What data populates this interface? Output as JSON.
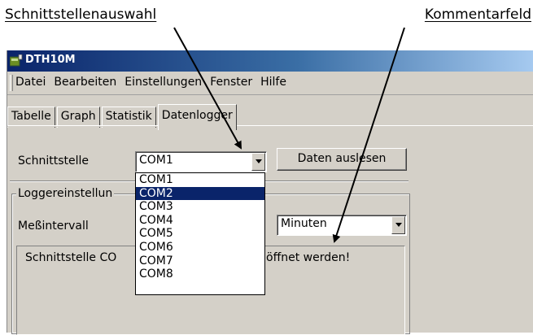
{
  "annotations": {
    "left": "Schnittstellenauswahl",
    "right": "Kommentarfeld"
  },
  "window": {
    "title": "DTH10M",
    "icon": "app-icon"
  },
  "menu": [
    "Datei",
    "Bearbeiten",
    "Einstellungen",
    "Fenster",
    "Hilfe"
  ],
  "tabs": [
    "Tabelle",
    "Graph",
    "Statistik",
    "Datenlogger"
  ],
  "active_tab": "Datenlogger",
  "interface": {
    "label": "Schnittstelle",
    "value": "COM1",
    "read_button": "Daten auslesen"
  },
  "dropdown": {
    "options": [
      "COM1",
      "COM2",
      "COM3",
      "COM4",
      "COM5",
      "COM6",
      "COM7",
      "COM8"
    ],
    "highlighted": "COM2"
  },
  "logger": {
    "group_label": "Loggereinstellun",
    "interval_label": "Meßintervall",
    "unit": "Minuten"
  },
  "comment": {
    "text_left": "Schnittstelle CO",
    "text_right": "öffnet werden!"
  },
  "colors": {
    "titlebar": "#0a246a",
    "selection": "#0a246a",
    "face": "#d4d0c8"
  }
}
